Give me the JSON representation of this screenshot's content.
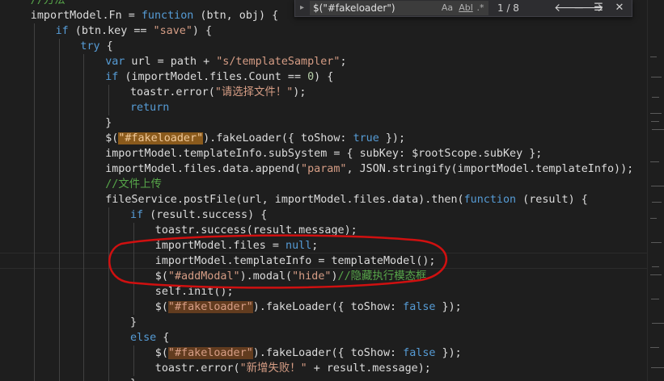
{
  "editor": {
    "lines": [
      {
        "indent": 1,
        "tokens": [
          {
            "t": "//方法",
            "c": "cmt"
          }
        ]
      },
      {
        "indent": 1,
        "tokens": [
          {
            "t": "importModel.Fn = ",
            "c": "ident"
          },
          {
            "t": "function",
            "c": "kw"
          },
          {
            "t": " (btn, obj) {",
            "c": "ident"
          }
        ]
      },
      {
        "indent": 2,
        "tokens": [
          {
            "t": "if",
            "c": "kw"
          },
          {
            "t": " (btn.key == ",
            "c": "ident"
          },
          {
            "t": "\"save\"",
            "c": "str"
          },
          {
            "t": ") {",
            "c": "ident"
          }
        ]
      },
      {
        "indent": 3,
        "tokens": [
          {
            "t": "try",
            "c": "kw"
          },
          {
            "t": " {",
            "c": "ident"
          }
        ]
      },
      {
        "indent": 4,
        "tokens": [
          {
            "t": "var",
            "c": "kw"
          },
          {
            "t": " url = path + ",
            "c": "ident"
          },
          {
            "t": "\"s/templateSampler\"",
            "c": "str"
          },
          {
            "t": ";",
            "c": "ident"
          }
        ]
      },
      {
        "indent": 4,
        "tokens": [
          {
            "t": "if",
            "c": "kw"
          },
          {
            "t": " (importModel.files.Count == ",
            "c": "ident"
          },
          {
            "t": "0",
            "c": "num"
          },
          {
            "t": ") {",
            "c": "ident"
          }
        ]
      },
      {
        "indent": 5,
        "tokens": [
          {
            "t": "toastr.error(",
            "c": "ident"
          },
          {
            "t": "\"请选择文件！\"",
            "c": "str"
          },
          {
            "t": ");",
            "c": "ident"
          }
        ]
      },
      {
        "indent": 5,
        "tokens": [
          {
            "t": "return",
            "c": "kw"
          }
        ]
      },
      {
        "indent": 4,
        "tokens": [
          {
            "t": "}",
            "c": "ident"
          }
        ]
      },
      {
        "indent": 4,
        "tokens": [
          {
            "t": "$(",
            "c": "ident"
          },
          {
            "t": "\"#fakeloader\"",
            "c": "match-active"
          },
          {
            "t": ").fakeLoader({ toShow: ",
            "c": "ident"
          },
          {
            "t": "true",
            "c": "kw"
          },
          {
            "t": " });",
            "c": "ident"
          }
        ]
      },
      {
        "indent": 4,
        "tokens": [
          {
            "t": "importModel.templateInfo.subSystem = { subKey: $rootScope.subKey };",
            "c": "ident"
          }
        ]
      },
      {
        "indent": 4,
        "tokens": [
          {
            "t": "importModel.files.data.append(",
            "c": "ident"
          },
          {
            "t": "\"param\"",
            "c": "str"
          },
          {
            "t": ", JSON.stringify(importModel.templateInfo));",
            "c": "ident"
          }
        ]
      },
      {
        "indent": 4,
        "tokens": [
          {
            "t": "//文件上传",
            "c": "cmt"
          }
        ]
      },
      {
        "indent": 4,
        "tokens": [
          {
            "t": "fileService.postFile(url, importModel.files.data).then(",
            "c": "ident"
          },
          {
            "t": "function",
            "c": "kw"
          },
          {
            "t": " (result) {",
            "c": "ident"
          }
        ]
      },
      {
        "indent": 5,
        "tokens": [
          {
            "t": "if",
            "c": "kw"
          },
          {
            "t": " (result.success) {",
            "c": "ident"
          }
        ]
      },
      {
        "indent": 6,
        "tokens": [
          {
            "t": "toastr.success(result.message);",
            "c": "ident"
          }
        ]
      },
      {
        "indent": 6,
        "tokens": [
          {
            "t": "importModel.files = ",
            "c": "ident"
          },
          {
            "t": "null",
            "c": "kw"
          },
          {
            "t": ";",
            "c": "ident"
          }
        ]
      },
      {
        "indent": 6,
        "tokens": [
          {
            "t": "importModel.templateInfo = templateModel();",
            "c": "ident"
          }
        ]
      },
      {
        "indent": 6,
        "tokens": [
          {
            "t": "$(",
            "c": "ident"
          },
          {
            "t": "\"#addModal\"",
            "c": "str"
          },
          {
            "t": ").modal(",
            "c": "ident"
          },
          {
            "t": "\"hide\"",
            "c": "str"
          },
          {
            "t": ")",
            "c": "ident"
          },
          {
            "t": "//隐藏执行模态框",
            "c": "cmt"
          }
        ]
      },
      {
        "indent": 6,
        "tokens": [
          {
            "t": "self.init();",
            "c": "ident"
          }
        ]
      },
      {
        "indent": 6,
        "tokens": [
          {
            "t": "$(",
            "c": "ident"
          },
          {
            "t": "\"#fakeloader\"",
            "c": "match"
          },
          {
            "t": ").fakeLoader({ toShow: ",
            "c": "ident"
          },
          {
            "t": "false",
            "c": "kw"
          },
          {
            "t": " });",
            "c": "ident"
          }
        ]
      },
      {
        "indent": 5,
        "tokens": [
          {
            "t": "}",
            "c": "ident"
          }
        ]
      },
      {
        "indent": 5,
        "tokens": [
          {
            "t": "else",
            "c": "kw"
          },
          {
            "t": " {",
            "c": "ident"
          }
        ]
      },
      {
        "indent": 6,
        "tokens": [
          {
            "t": "$(",
            "c": "ident"
          },
          {
            "t": "\"#fakeloader\"",
            "c": "match"
          },
          {
            "t": ").fakeLoader({ toShow: ",
            "c": "ident"
          },
          {
            "t": "false",
            "c": "kw"
          },
          {
            "t": " });",
            "c": "ident"
          }
        ]
      },
      {
        "indent": 6,
        "tokens": [
          {
            "t": "toastr.error(",
            "c": "ident"
          },
          {
            "t": "\"新增失败！\"",
            "c": "str"
          },
          {
            "t": " + result.message);",
            "c": "ident"
          }
        ]
      },
      {
        "indent": 5,
        "tokens": [
          {
            "t": "}",
            "c": "ident"
          }
        ]
      }
    ]
  },
  "find": {
    "query": "$(\"#fakeloader\")",
    "match_case_label": "Aa",
    "whole_word_label": "Abl",
    "regex_label": ".*",
    "match_count": "1 / 8",
    "prev_icon": "arrow-up-icon",
    "next_icon": "arrow-down-icon",
    "selection_icon": "selection-icon",
    "close_icon": "close-icon"
  },
  "annotation": {
    "color": "#d01010",
    "description_icon": "red-ellipse-annotation"
  },
  "colors": {
    "background": "#1e1e1e",
    "keyword": "#569cd6",
    "string": "#d69d85",
    "comment": "#57a64a",
    "number": "#b5cea8",
    "identifier": "#dcdcdc",
    "find_match": "#623c1f"
  }
}
